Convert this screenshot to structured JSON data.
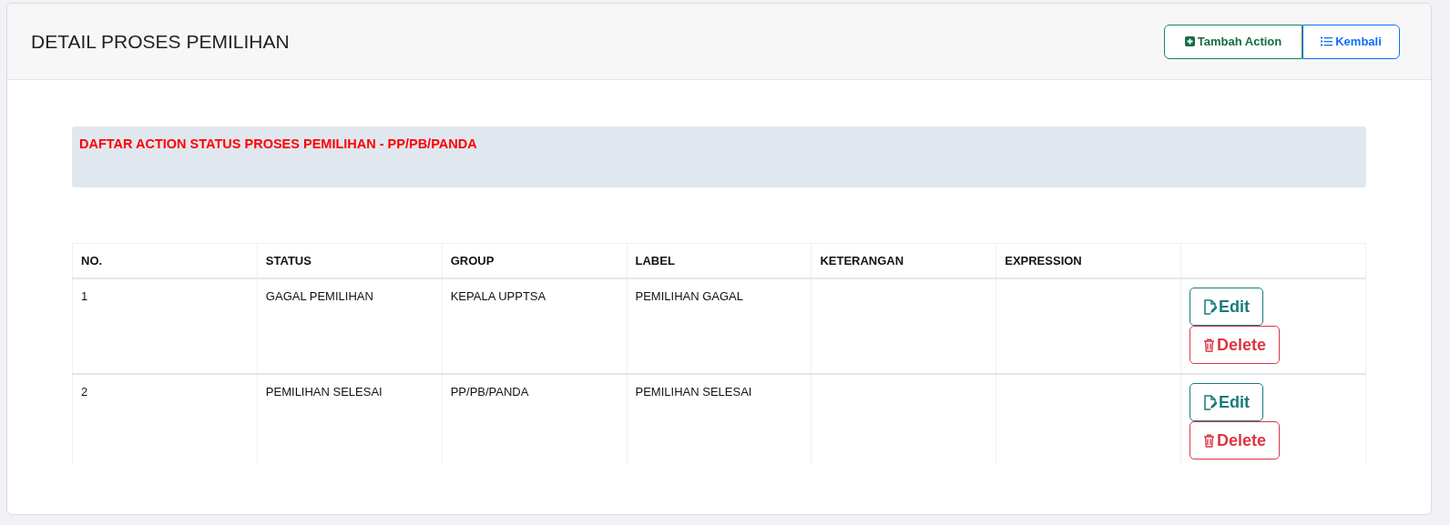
{
  "page_title": "DETAIL PROSES PEMILIHAN",
  "header_buttons": [
    {
      "label": "Tambah Action",
      "kind": "add"
    },
    {
      "label": "Kembali",
      "kind": "back"
    }
  ],
  "alert": "DAFTAR ACTION STATUS PROSES PEMILIHAN - PP/PB/PANDA",
  "table": {
    "columns": [
      "NO.",
      "STATUS",
      "GROUP",
      "LABEL",
      "KETERANGAN",
      "EXPRESSION"
    ],
    "rows": [
      {
        "cells": [
          "1",
          "GAGAL PEMILIHAN",
          "KEPALA UPPTSA",
          "PEMILIHAN GAGAL",
          "",
          ""
        ],
        "actions": [
          "Edit",
          "Delete"
        ]
      },
      {
        "cells": [
          "2",
          "PEMILIHAN SELESAI",
          "PP/PB/PANDA",
          "PEMILIHAN SELESAI",
          "",
          ""
        ],
        "actions": [
          "Edit",
          "Delete"
        ]
      }
    ]
  }
}
